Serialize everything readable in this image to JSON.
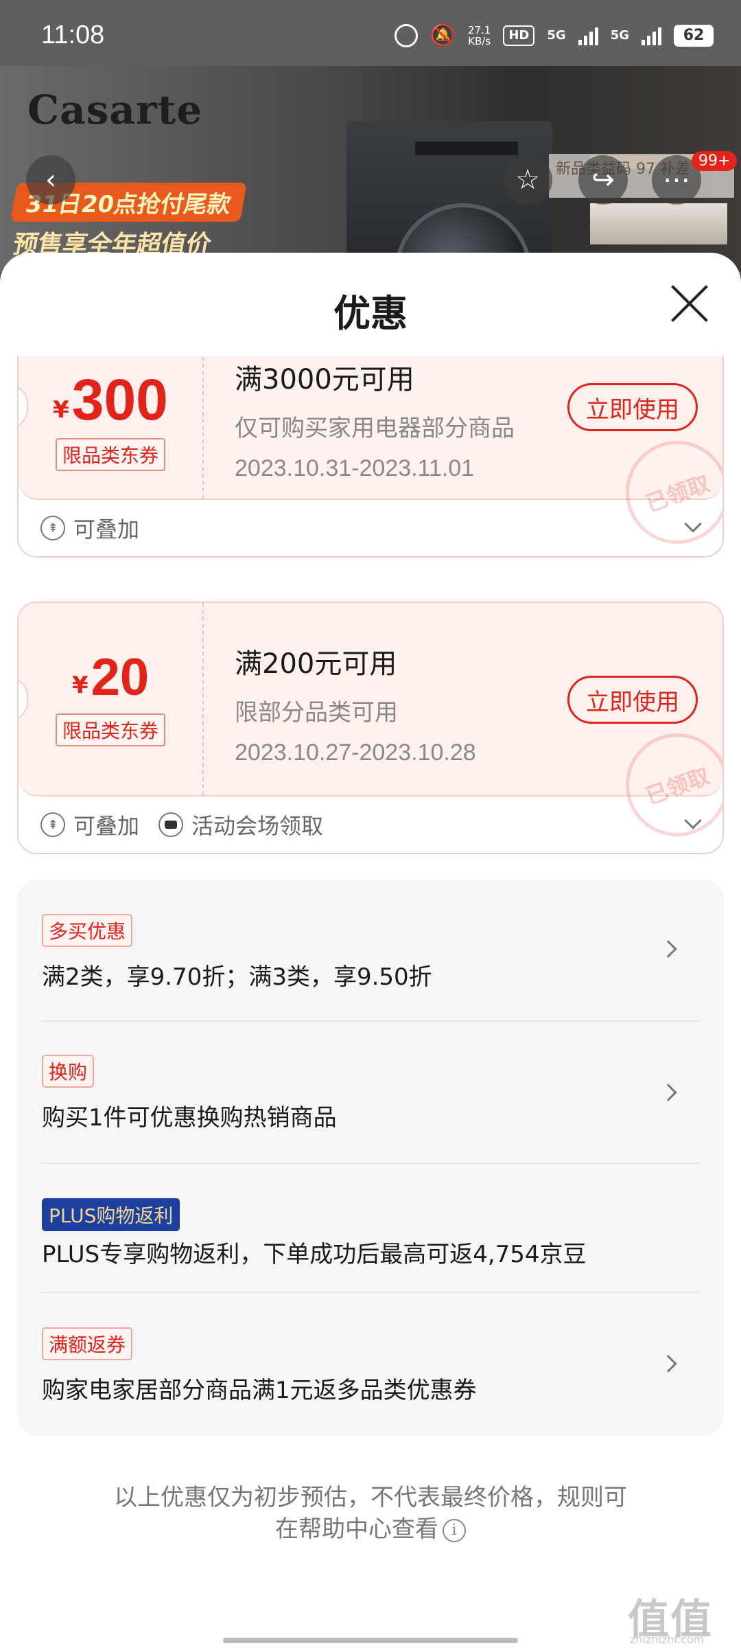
{
  "status_bar": {
    "time": "11:08",
    "net_speed_value": "27.1",
    "net_speed_unit": "KB/s",
    "hd_label": "HD",
    "sim1_label": "5G",
    "sim2_label": "5G",
    "battery": "62"
  },
  "hero": {
    "brand": "Casarte",
    "promo_line1": "31日20点抢付尾款",
    "promo_line2": "预售享全年超值价",
    "rank_text": "新品类益码 97 补差",
    "cart_badge": "99+"
  },
  "sheet": {
    "title": "优惠"
  },
  "coupons": [
    {
      "currency": "¥",
      "amount": "300",
      "type": "限品类东券",
      "condition": "满3000元可用",
      "scope": "仅可购买家用电器部分商品",
      "date_range": "2023.10.31-2023.11.01",
      "use_label": "立即使用",
      "stamp": "已领取",
      "tags": [
        "可叠加"
      ]
    },
    {
      "currency": "¥",
      "amount": "20",
      "type": "限品类东券",
      "condition": "满200元可用",
      "scope": "限部分品类可用",
      "date_range": "2023.10.27-2023.10.28",
      "use_label": "立即使用",
      "stamp": "已领取",
      "tags": [
        "可叠加",
        "活动会场领取"
      ]
    }
  ],
  "offers": [
    {
      "tag": "多买优惠",
      "text": "满2类，享9.70折；满3类，享9.50折"
    },
    {
      "tag": "换购",
      "text": "购买1件可优惠换购热销商品"
    },
    {
      "tag": "PLUS购物返利",
      "text": "PLUS专享购物返利，下单成功后最高可返4,754京豆"
    },
    {
      "tag": "满额返券",
      "text": "购家电家居部分商品满1元返多品类优惠券"
    }
  ],
  "disclaimer": {
    "line1": "以上优惠仅为初步预估，不代表最终价格，规则可",
    "line2": "在帮助中心查看"
  },
  "watermark": {
    "text": "值值值",
    "url": "zhizhizhi.com"
  }
}
